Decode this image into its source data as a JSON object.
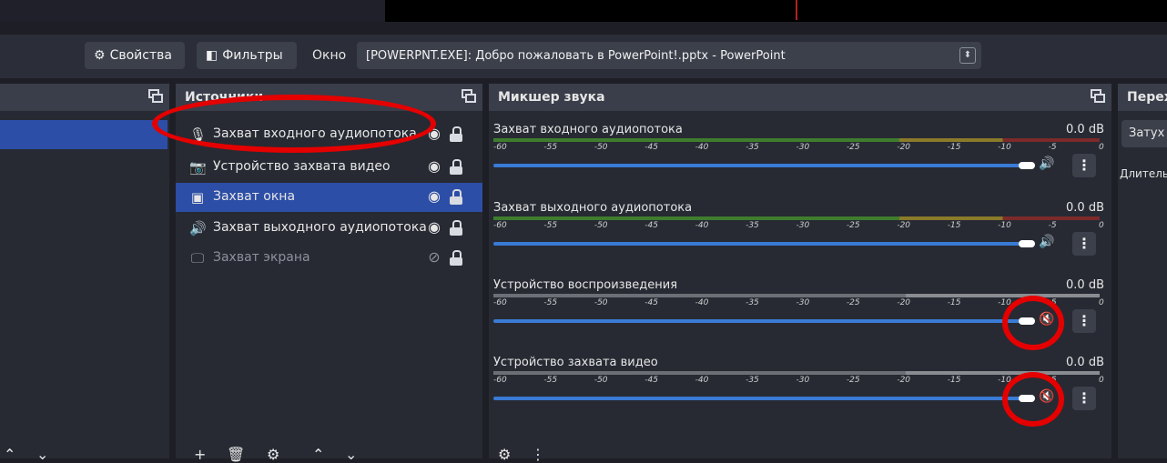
{
  "toolbar": {
    "properties_label": "Свойства",
    "filters_label": "Фильтры",
    "window_label": "Окно",
    "window_value": "[POWERPNT.EXE]: Добро пожаловать в PowerPoint!.pptx - PowerPoint"
  },
  "sources": {
    "title": "Источники",
    "items": [
      {
        "name": "Захват входного аудиопотока",
        "icon": "microphone-icon"
      },
      {
        "name": "Устройство захвата видео",
        "icon": "camera-icon"
      },
      {
        "name": "Захват окна",
        "icon": "window-icon"
      },
      {
        "name": "Захват выходного аудиопотока",
        "icon": "speaker-icon"
      },
      {
        "name": "Захват экрана",
        "icon": "monitor-icon"
      }
    ]
  },
  "mixer": {
    "title": "Микшер звука",
    "channels": [
      {
        "name": "Захват входного аудиопотока",
        "db": "0.0 dB",
        "muted": false
      },
      {
        "name": "Захват выходного аудиопотока",
        "db": "0.0 dB",
        "muted": false
      },
      {
        "name": "Устройство воспроизведения",
        "db": "0.0 dB",
        "muted": true
      },
      {
        "name": "Устройство захвата видео",
        "db": "0.0 dB",
        "muted": true
      }
    ],
    "scale": [
      "-60",
      "-55",
      "-50",
      "-45",
      "-40",
      "-35",
      "-30",
      "-25",
      "-20",
      "-15",
      "-10",
      "-5",
      "0"
    ]
  },
  "transitions": {
    "title": "Перех",
    "select_value": "Затух",
    "duration_label": "Длитель"
  },
  "colors": {
    "accent": "#2d4ea6",
    "annotation": "#e50000",
    "meter_green": "#3f7d2e",
    "meter_yellow": "#8a7a2a",
    "meter_red": "#7d2a2a",
    "volume_blue": "#3a7bd5"
  }
}
